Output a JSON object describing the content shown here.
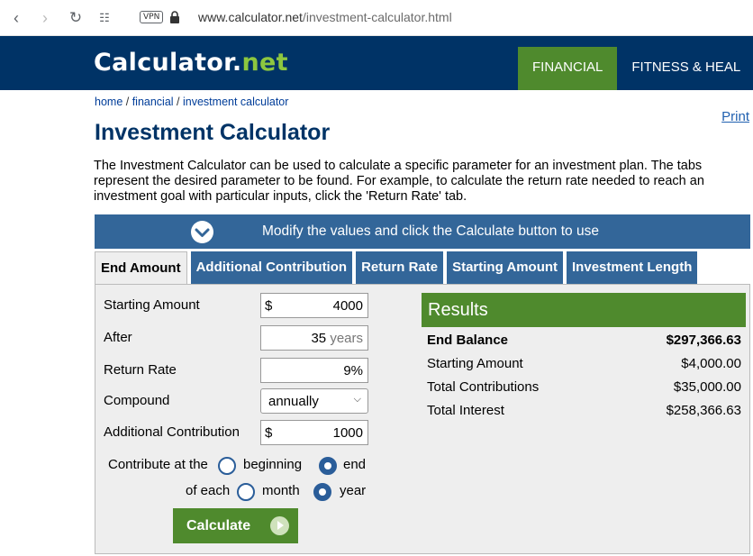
{
  "browser": {
    "url_host": "www.calculator.net",
    "url_path": "/investment-calculator.html",
    "vpn_label": "VPN"
  },
  "site": {
    "logo_main": "Calculator",
    "logo_dot": ".",
    "logo_net": "net",
    "nav": [
      "FINANCIAL",
      "FITNESS & HEAL"
    ]
  },
  "breadcrumb": {
    "home": "home",
    "sep": " / ",
    "financial": "financial",
    "current": "investment calculator"
  },
  "print_label": "Print",
  "page_title": "Investment Calculator",
  "intro_text": "The Investment Calculator can be used to calculate a specific parameter for an investment plan. The tabs represent the desired parameter to be found. For example, to calculate the return rate needed to reach an investment goal with particular inputs, click the 'Return Rate' tab.",
  "banner_text": "Modify the values and click the Calculate button to use",
  "tabs": [
    "End Amount",
    "Additional Contribution",
    "Return Rate",
    "Starting Amount",
    "Investment Length"
  ],
  "form": {
    "starting_amount": {
      "label": "Starting Amount",
      "prefix": "$",
      "value": "4000"
    },
    "after": {
      "label": "After",
      "value": "35",
      "unit": "years"
    },
    "return_rate": {
      "label": "Return Rate",
      "value": "9%"
    },
    "compound": {
      "label": "Compound",
      "value": "annually"
    },
    "additional": {
      "label": "Additional Contribution",
      "prefix": "$",
      "value": "1000"
    },
    "contribute_at": {
      "label": "Contribute at the",
      "opt1": "beginning",
      "opt2": "end",
      "selected": "end"
    },
    "of_each": {
      "label": "of each",
      "opt1": "month",
      "opt2": "year",
      "selected": "year"
    },
    "calculate_label": "Calculate"
  },
  "results": {
    "title": "Results",
    "rows": [
      {
        "label": "End Balance",
        "value": "$297,366.63"
      },
      {
        "label": "Starting Amount",
        "value": "$4,000.00"
      },
      {
        "label": "Total Contributions",
        "value": "$35,000.00"
      },
      {
        "label": "Total Interest",
        "value": "$258,366.63"
      }
    ]
  },
  "colors": {
    "header_navy": "#003366",
    "accent_green": "#4f8a2d",
    "tab_blue": "#336699"
  }
}
